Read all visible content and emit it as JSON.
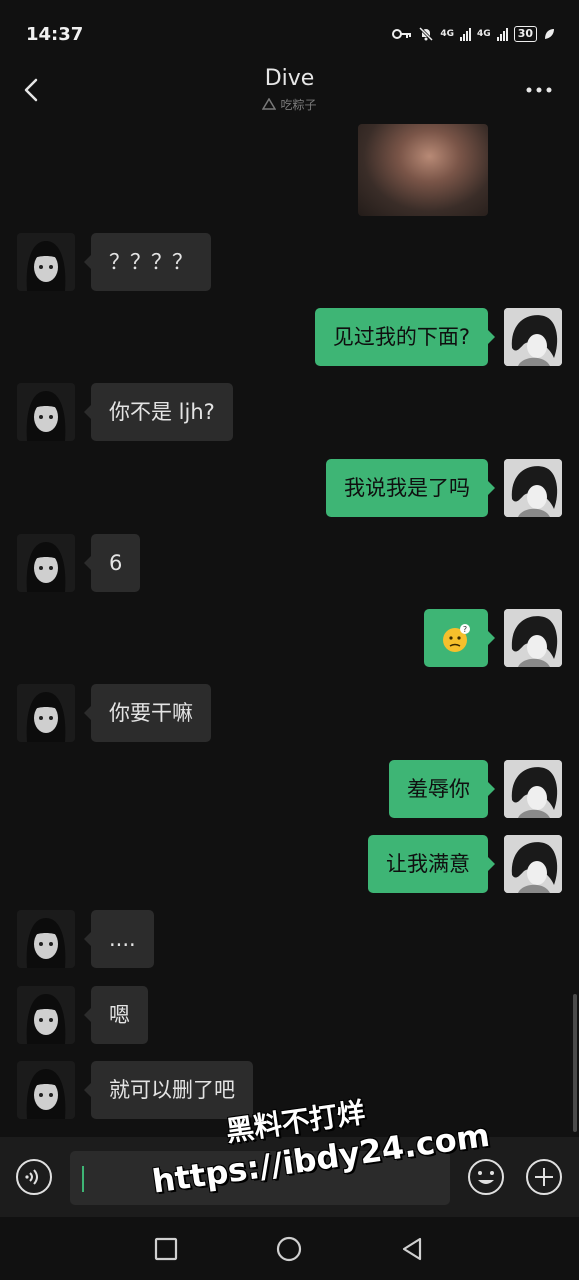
{
  "status_bar": {
    "time": "14:37",
    "network_1": "4G",
    "network_2": "4G",
    "battery": "30"
  },
  "header": {
    "title": "Dive",
    "subtitle": "吃粽子"
  },
  "messages": [
    {
      "from": "them",
      "text": "？？？？"
    },
    {
      "from": "me",
      "text": "见过我的下面?"
    },
    {
      "from": "them",
      "text": "你不是 ljh?"
    },
    {
      "from": "me",
      "text": "我说我是了吗"
    },
    {
      "from": "them",
      "text": "6"
    },
    {
      "from": "me",
      "emoji": "confused-face-sticker"
    },
    {
      "from": "them",
      "text": "你要干嘛"
    },
    {
      "from": "me",
      "text": "羞辱你"
    },
    {
      "from": "me",
      "text": "让我满意"
    },
    {
      "from": "them",
      "text": "...."
    },
    {
      "from": "them",
      "text": "嗯"
    },
    {
      "from": "them",
      "text": "就可以删了吧"
    }
  ],
  "watermark": {
    "line1": "黑料不打烊",
    "line2": "https://ibdy24.com"
  },
  "colors": {
    "self_bubble": "#3eb575",
    "other_bubble": "#2c2c2c",
    "background": "#111111"
  }
}
